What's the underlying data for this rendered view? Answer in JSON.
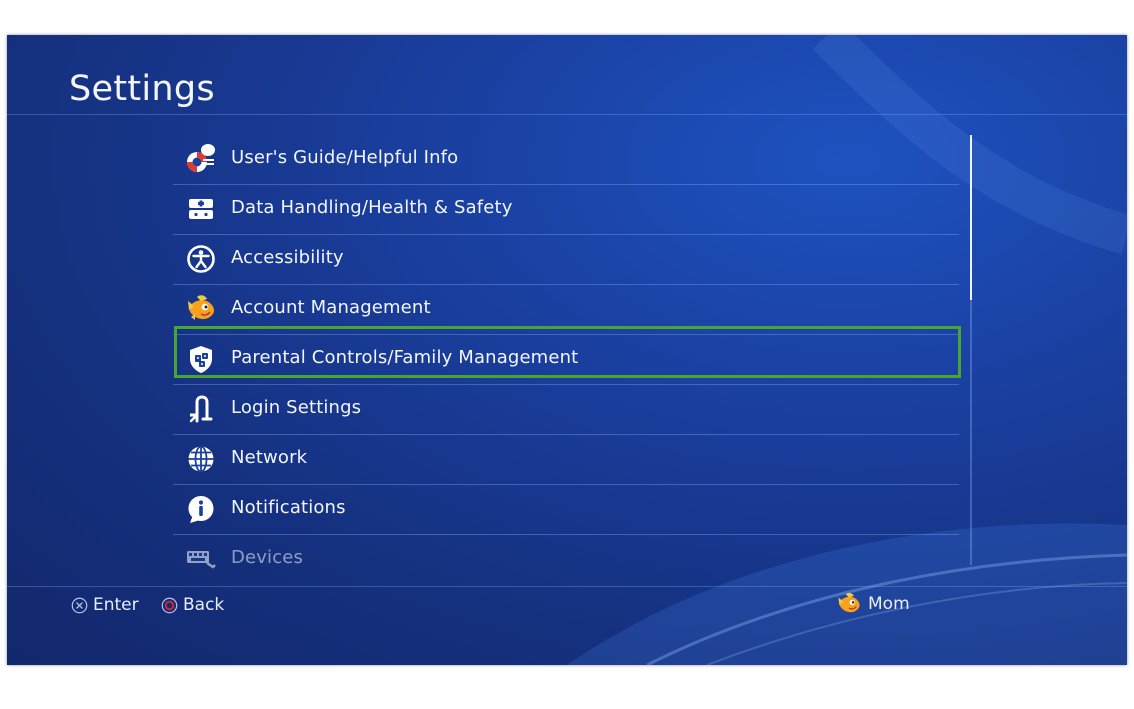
{
  "screen": {
    "title": "Settings"
  },
  "menu": {
    "items": [
      {
        "label": "User's Guide/Helpful Info",
        "icon": "lifebuoy-info-icon"
      },
      {
        "label": "Data Handling/Health & Safety",
        "icon": "data-health-icon"
      },
      {
        "label": "Accessibility",
        "icon": "accessibility-icon"
      },
      {
        "label": "Account Management",
        "icon": "avatar-fish-icon"
      },
      {
        "label": "Parental Controls/Family Management",
        "icon": "parental-controls-icon",
        "selected": true
      },
      {
        "label": "Login Settings",
        "icon": "login-icon"
      },
      {
        "label": "Network",
        "icon": "globe-icon"
      },
      {
        "label": "Notifications",
        "icon": "info-bubble-icon"
      },
      {
        "label": "Devices",
        "icon": "keyboard-icon"
      }
    ],
    "selected_index": 4
  },
  "footer": {
    "enter_label": "Enter",
    "back_label": "Back",
    "user_name": "Mom"
  },
  "colors": {
    "background": "#1a3f9f",
    "selection_border": "#4aa432",
    "text": "#f2f6ff",
    "back_button": "#d8262a"
  }
}
